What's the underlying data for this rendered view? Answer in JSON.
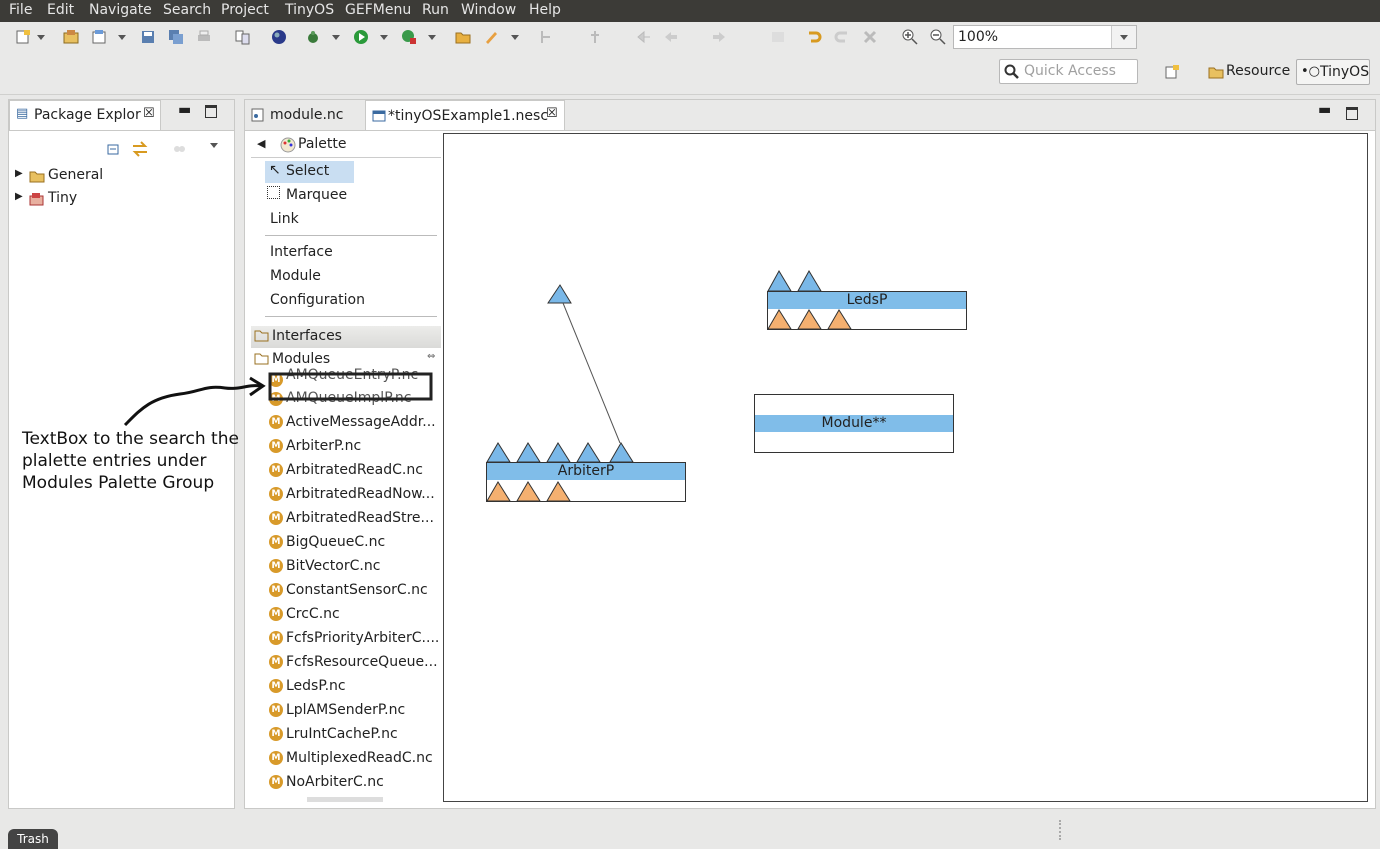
{
  "menu": [
    "File",
    "Edit",
    "Navigate",
    "Search",
    "Project",
    "TinyOS",
    "GEFMenu",
    "Run",
    "Window",
    "Help"
  ],
  "toolbar": {
    "zoom_value": "100%"
  },
  "quick_access": {
    "placeholder": "Quick Access"
  },
  "perspectives": {
    "resource": "Resource",
    "tinyos": "TinyOS"
  },
  "package_explorer": {
    "tab_title": "Package Explor",
    "items": [
      {
        "label": "General",
        "icon": "folder-icon"
      },
      {
        "label": "Tiny",
        "icon": "project-icon"
      }
    ]
  },
  "editor": {
    "tabs": [
      {
        "label": "module.nc",
        "active": false
      },
      {
        "label": "*tinyOSExample1.nesc",
        "active": true
      }
    ]
  },
  "palette": {
    "title": "Palette",
    "tools": [
      "Select",
      "Marquee",
      "Link"
    ],
    "creation": [
      "Interface",
      "Module",
      "Configuration"
    ],
    "drawers": [
      "Interfaces",
      "Modules"
    ],
    "modules": [
      "AMQueueEntryP.nc",
      "AMQueueImplP.nc",
      "ActiveMessageAddr...",
      "ArbiterP.nc",
      "ArbitratedReadC.nc",
      "ArbitratedReadNow...",
      "ArbitratedReadStre...",
      "BigQueueC.nc",
      "BitVectorC.nc",
      "ConstantSensorC.nc",
      "CrcC.nc",
      "FcfsPriorityArbiterC....",
      "FcfsResourceQueue...",
      "LedsP.nc",
      "LplAMSenderP.nc",
      "LruIntCacheP.nc",
      "MultiplexedReadC.nc",
      "NoArbiterC.nc"
    ]
  },
  "diagram": {
    "nodes": [
      {
        "name": "LedsP",
        "provides": 2,
        "uses": 3
      },
      {
        "name": "Module**",
        "provides": 0,
        "uses": 0
      },
      {
        "name": "ArbiterP",
        "provides": 5,
        "uses": 3
      }
    ]
  },
  "annotation": "TextBox to the search the plalette entries under Modules Palette Group",
  "trash_label": "Trash",
  "colors": {
    "provide_triangle": "#7ab8e8",
    "use_triangle": "#f4b070",
    "node_bar": "#80bde9"
  }
}
